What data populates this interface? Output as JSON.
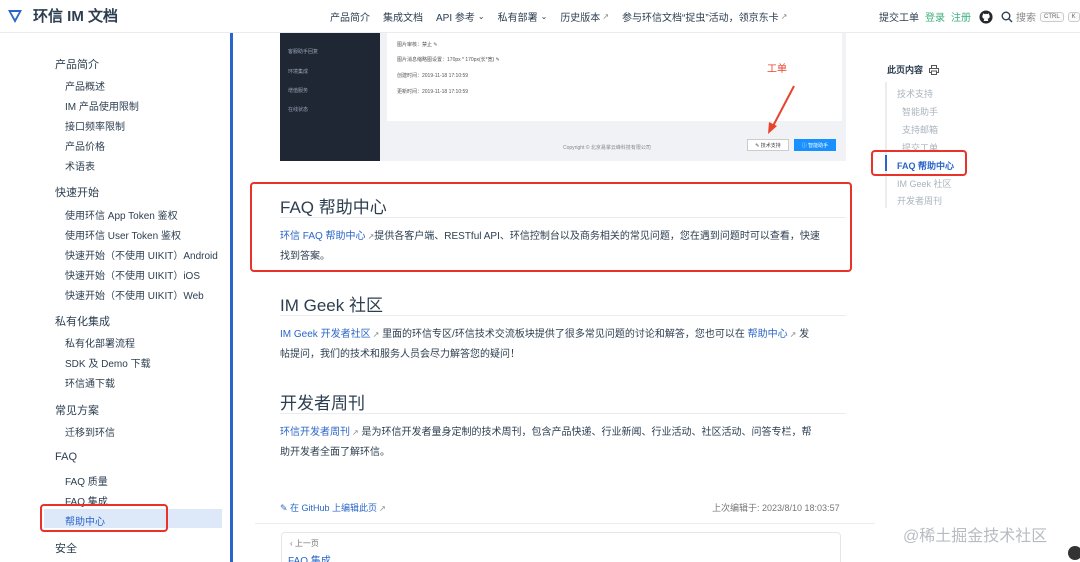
{
  "header": {
    "title": "环信 IM 文档",
    "nav": [
      {
        "label": "产品简介"
      },
      {
        "label": "集成文档"
      },
      {
        "label": "API 参考",
        "caret": "⌄"
      },
      {
        "label": "私有部署",
        "caret": "⌄"
      },
      {
        "label": "历史版本",
        "ext": "↗"
      },
      {
        "label": "参与环信文档“捉虫”活动，领京东卡",
        "ext": "↗"
      }
    ],
    "submit_ticket": "提交工单",
    "login": "登录",
    "register": "注册",
    "search_placeholder": "搜索",
    "kbd_ctrl": "CTRL",
    "kbd_k": "K"
  },
  "sidebar": {
    "groups": [
      {
        "label": "产品简介",
        "items": [
          "产品概述",
          "IM 产品使用限制",
          "接口频率限制",
          "产品价格",
          "术语表"
        ]
      },
      {
        "label": "快速开始",
        "items": [
          "使用环信 App Token 鉴权",
          "使用环信 User Token 鉴权",
          "快速开始（不使用 UIKIT）Android",
          "快速开始（不使用 UIKIT）iOS",
          "快速开始（不使用 UIKIT）Web"
        ]
      },
      {
        "label": "私有化集成",
        "items": [
          "私有化部署流程",
          "SDK 及 Demo 下载",
          "环信通下载"
        ]
      },
      {
        "label": "常见方案",
        "items": [
          "迁移到环信"
        ]
      },
      {
        "label": "FAQ",
        "items": [
          "FAQ 质量",
          "FAQ 集成",
          "帮助中心"
        ]
      },
      {
        "label": "安全",
        "items": []
      }
    ],
    "active_item": "帮助中心"
  },
  "screenshot": {
    "menu": [
      "客服助手回复",
      "环境集成",
      "增值服务",
      "在线状态"
    ],
    "lines": [
      "图片审核：禁止 ✎",
      "图片消息缩略图设置：170px * 170px(长*宽) ✎",
      "创建时间：2019-11-18 17:10:59",
      "更新时间：2019-11-18 17:10:59"
    ],
    "footer": "Copyright © 北京易掌云峰科技有限公司",
    "btn_support": "✎ 技术支持",
    "btn_assist": "ⓘ 智能助手",
    "annotation": "工单"
  },
  "content": {
    "faq": {
      "heading": "FAQ 帮助中心",
      "link": "环信 FAQ 帮助中心",
      "text_line1": "提供各客户端、RESTful API、环信控制台以及商务相关的常见问题，您在遇到问题时可以查看，快速",
      "text_line2": "找到答案。"
    },
    "geek": {
      "heading": "IM Geek 社区",
      "link1": "IM Geek 开发者社区",
      "mid": "里面的环信专区/环信技术交流板块提供了很多常见问题的讨论和解答，您也可以在",
      "link2": "帮助中心",
      "tail": "发",
      "line2": "帖提问，我们的技术和服务人员会尽力解答您的疑问！"
    },
    "weekly": {
      "heading": "开发者周刊",
      "link": "环信开发者周刊",
      "text_line1": "是为环信开发者量身定制的技术周刊，包含产品快递、行业新闻、行业活动、社区活动、问答专栏，帮",
      "text_line2": "助开发者全面了解环信。"
    },
    "edit_link": "在 GitHub 上编辑此页",
    "updated": "上次编辑于: 2023/8/10 18:03:57",
    "prev_label": "‹ 上一页",
    "prev_title": "FAQ 集成"
  },
  "toc": {
    "title": "此页内容",
    "items": [
      {
        "label": "技术支持",
        "level": 1
      },
      {
        "label": "智能助手",
        "level": 2
      },
      {
        "label": "支持邮箱",
        "level": 2
      },
      {
        "label": "提交工单",
        "level": 2
      },
      {
        "label": "FAQ 帮助中心",
        "level": 1,
        "active": true
      },
      {
        "label": "IM Geek 社区",
        "level": 1
      },
      {
        "label": "开发者周刊",
        "level": 1
      }
    ]
  },
  "watermark": "@稀土掘金技术社区",
  "colors": {
    "accent": "#2a66c9",
    "highlight": "#e8322a",
    "green": "#3eaf7c"
  }
}
